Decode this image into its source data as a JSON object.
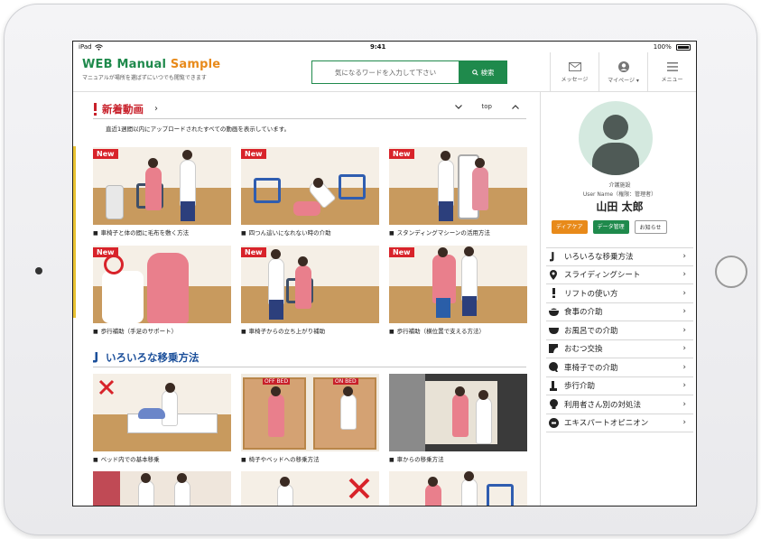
{
  "status_bar": {
    "device": "iPad",
    "time": "9:41",
    "battery": "100%"
  },
  "header": {
    "brand_web": "WEB Manual",
    "brand_sample": "Sample",
    "tagline": "マニュアルが場所を選ばずにいつでも閲覧できます",
    "search_placeholder": "気になるワードを入力して下さい",
    "search_button": "検索",
    "buttons": [
      {
        "label": "メッセージ",
        "icon": "mail-icon"
      },
      {
        "label": "マイページ ▾",
        "icon": "user-icon"
      },
      {
        "label": "メニュー",
        "icon": "menu-icon"
      }
    ]
  },
  "new_videos": {
    "title": "新着動画",
    "arrow": "›",
    "top_label": "top",
    "description": "直近1週間以内にアップロードされたすべての動画を表示しています。",
    "badge": "New",
    "items": [
      {
        "caption": "車椅子と体の間に毛布を敷く方法"
      },
      {
        "caption": "四つん這いになれない時の介助"
      },
      {
        "caption": "スタンディングマシーンの活用方法"
      },
      {
        "caption": "歩行補助（手足のサポート）"
      },
      {
        "caption": "車椅子からの立ち上がり補助"
      },
      {
        "caption": "歩行補助（横位置で支える方法）"
      }
    ]
  },
  "transfer_methods": {
    "title": "いろいろな移乗方法",
    "items": [
      {
        "caption": "ベッド内での基本移乗"
      },
      {
        "caption": "椅子やベッドへの移乗方法",
        "overlay_left": "OFF BED",
        "overlay_right": "ON BED"
      },
      {
        "caption": "車からの移乗方法"
      }
    ]
  },
  "profile": {
    "role": "介護施設",
    "username_label": "User Name（権限：管理者）",
    "name": "山田 太郎",
    "tags": [
      "ディアケア",
      "データ管理",
      "お知らせ"
    ]
  },
  "side_menu": [
    {
      "label": "いろいろな移乗方法",
      "icon": "transfer-icon"
    },
    {
      "label": "スライディングシート",
      "icon": "pin-icon"
    },
    {
      "label": "リフトの使い方",
      "icon": "lift-icon"
    },
    {
      "label": "食事の介助",
      "icon": "bowl-icon"
    },
    {
      "label": "お風呂での介助",
      "icon": "bath-icon"
    },
    {
      "label": "おむつ交換",
      "icon": "diaper-icon"
    },
    {
      "label": "車椅子での介助",
      "icon": "wheelchair-icon"
    },
    {
      "label": "歩行介助",
      "icon": "walk-icon"
    },
    {
      "label": "利用者さん別の対処法",
      "icon": "person-icon"
    },
    {
      "label": "エキスパートオピニオン",
      "icon": "expert-icon"
    }
  ],
  "colors": {
    "brand_green": "#1f8a4c",
    "brand_orange": "#e88a1a",
    "accent_red": "#c8202a",
    "accent_blue": "#1b4f9a"
  }
}
